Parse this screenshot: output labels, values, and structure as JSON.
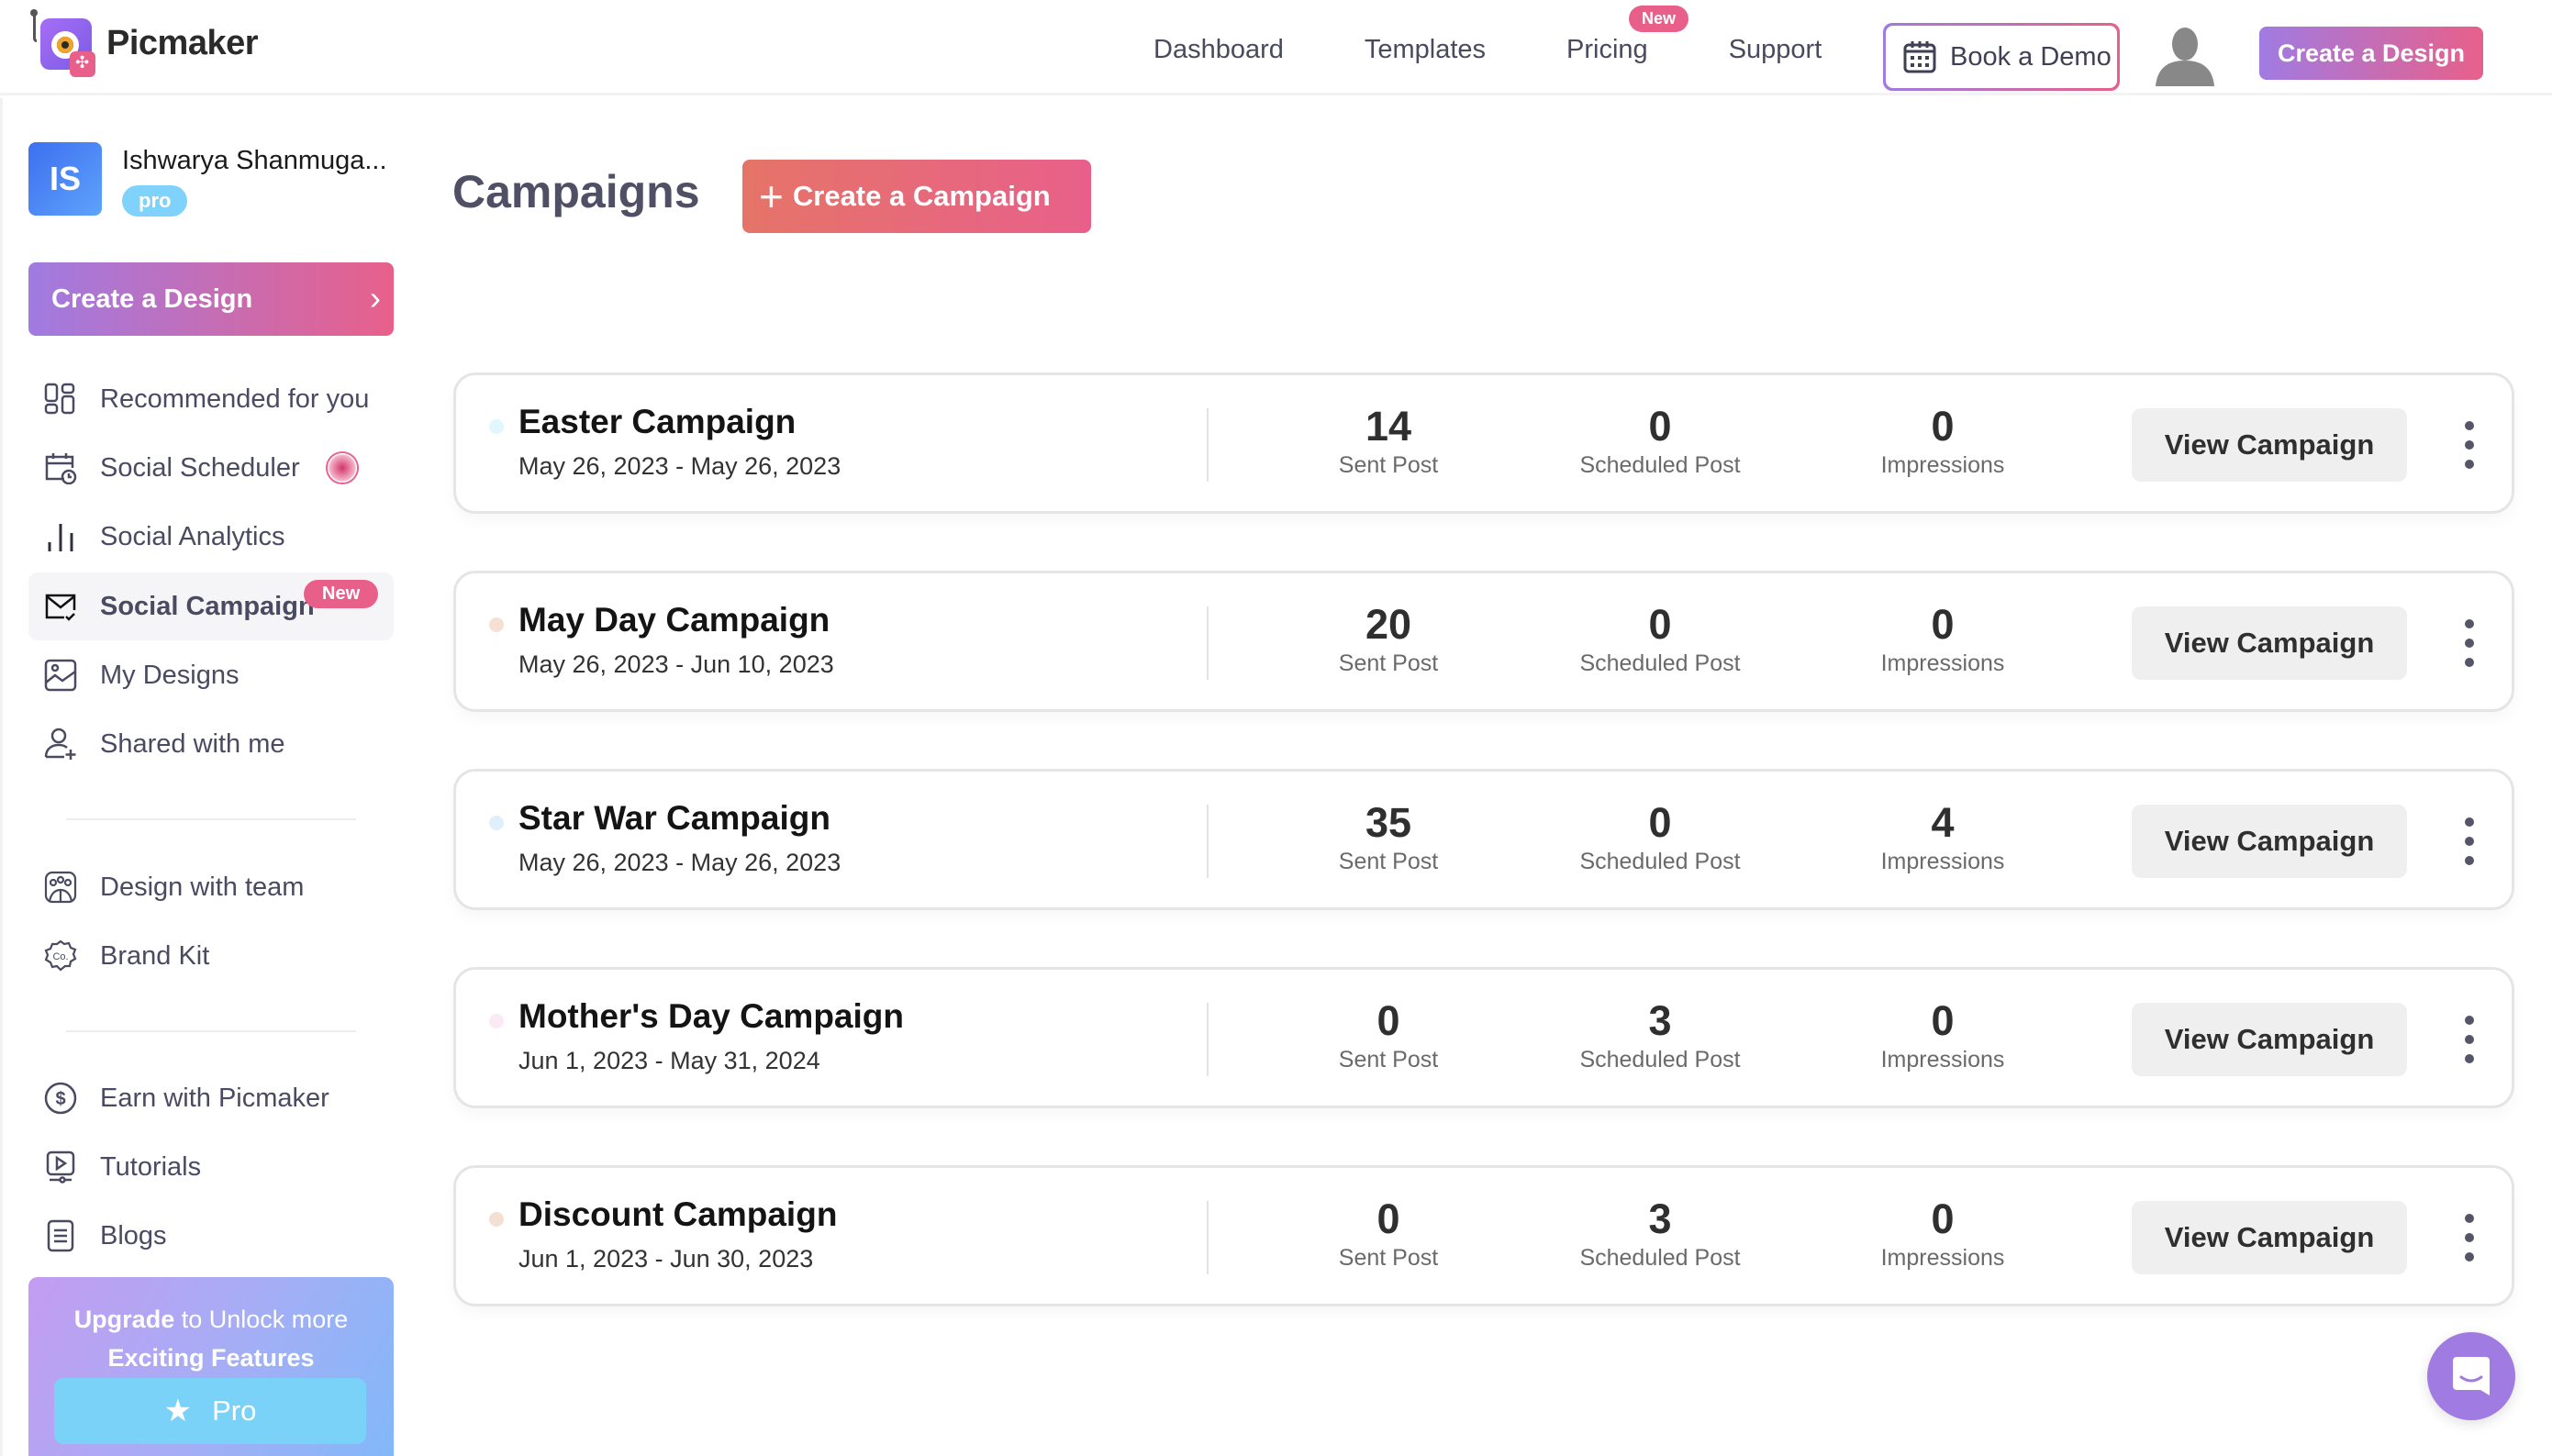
{
  "app": {
    "name": "Picmaker"
  },
  "topnav": {
    "items": [
      {
        "label": "Dashboard"
      },
      {
        "label": "Templates"
      },
      {
        "label": "Pricing",
        "badge": "New"
      },
      {
        "label": "Support"
      }
    ],
    "book_demo": "Book a Demo",
    "create_design": "Create a Design"
  },
  "sidebar": {
    "user": {
      "initials": "IS",
      "name": "Ishwarya Shanmuga...",
      "plan": "pro"
    },
    "create_design": "Create a Design",
    "items": [
      {
        "label": "Recommended for you",
        "icon": "layout-grid-icon"
      },
      {
        "label": "Social Scheduler",
        "icon": "calendar-clock-icon",
        "indicator": "pulse"
      },
      {
        "label": "Social Analytics",
        "icon": "bar-chart-icon"
      },
      {
        "label": "Social Campaign",
        "icon": "mail-check-icon",
        "badge": "New",
        "active": true
      },
      {
        "label": "My Designs",
        "icon": "image-icon"
      },
      {
        "label": "Shared with me",
        "icon": "user-plus-icon"
      },
      {
        "label": "Design with team",
        "icon": "team-icon"
      },
      {
        "label": "Brand Kit",
        "icon": "brand-badge-icon"
      },
      {
        "label": "Earn with Picmaker",
        "icon": "dollar-circle-icon"
      },
      {
        "label": "Tutorials",
        "icon": "video-play-icon"
      },
      {
        "label": "Blogs",
        "icon": "document-icon"
      }
    ],
    "upgrade": {
      "line1_bold": "Upgrade",
      "line1_rest": " to Unlock more",
      "line2": "Exciting Features",
      "button": "Pro"
    }
  },
  "main": {
    "title": "Campaigns",
    "create_button": "Create a Campaign",
    "stat_labels": {
      "sent": "Sent Post",
      "scheduled": "Scheduled Post",
      "impressions": "Impressions"
    },
    "view_label": "View Campaign",
    "campaigns": [
      {
        "name": "Easter Campaign",
        "dates": "May 26, 2023 - May 26, 2023",
        "sent": "14",
        "scheduled": "0",
        "impressions": "0",
        "dot_color": "#dff7fd"
      },
      {
        "name": "May Day Campaign",
        "dates": "May 26, 2023 - Jun 10, 2023",
        "sent": "20",
        "scheduled": "0",
        "impressions": "0",
        "dot_color": "#f6e0d5"
      },
      {
        "name": "Star War Campaign",
        "dates": "May 26, 2023 - May 26, 2023",
        "sent": "35",
        "scheduled": "0",
        "impressions": "4",
        "dot_color": "#e1effd"
      },
      {
        "name": "Mother's Day Campaign",
        "dates": "Jun 1, 2023 - May 31, 2024",
        "sent": "0",
        "scheduled": "3",
        "impressions": "0",
        "dot_color": "#fbeaf3"
      },
      {
        "name": "Discount Campaign",
        "dates": "Jun 1, 2023 - Jun 30, 2023",
        "sent": "0",
        "scheduled": "3",
        "impressions": "0",
        "dot_color": "#f5dfd2"
      }
    ]
  },
  "colors": {
    "brand_purple": "#a07be2",
    "brand_pink": "#e8608a",
    "campaign_orange": "#e57468",
    "pro_blue": "#7ad2f9"
  }
}
